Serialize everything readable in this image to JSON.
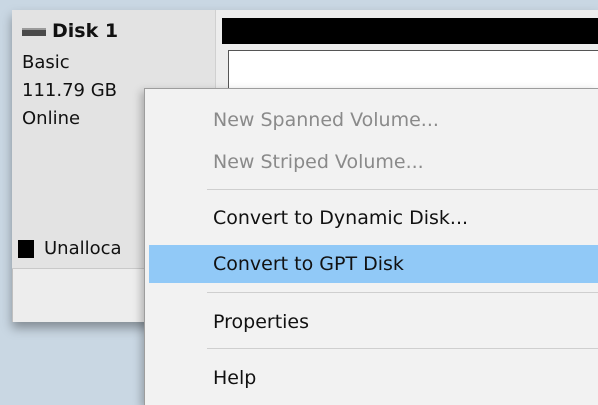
{
  "disk": {
    "name": "Disk 1",
    "type": "Basic",
    "size": "111.79 GB",
    "status": "Online",
    "icon": "disk-icon"
  },
  "legend": {
    "label": "Unalloca",
    "swatch_color": "#000000"
  },
  "context_menu": {
    "items": [
      {
        "label": "New Spanned Volume...",
        "enabled": false
      },
      {
        "label": "New Striped Volume...",
        "enabled": false
      },
      {
        "label": "Convert to Dynamic Disk...",
        "enabled": true
      },
      {
        "label": "Convert to GPT Disk",
        "enabled": true,
        "highlighted": true
      },
      {
        "label": "Properties",
        "enabled": true
      },
      {
        "label": "Help",
        "enabled": true
      }
    ],
    "highlight_color": "#91c9f7"
  }
}
